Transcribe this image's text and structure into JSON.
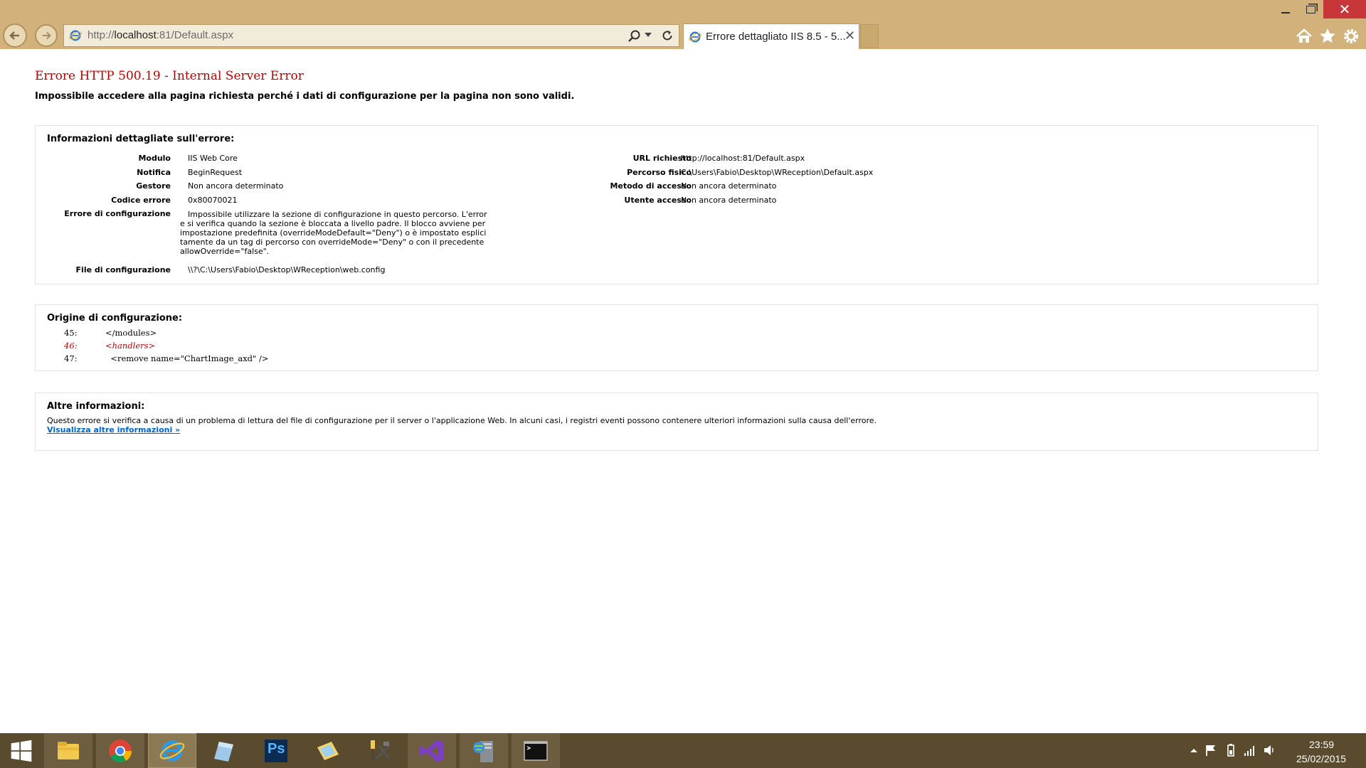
{
  "browser": {
    "url_prefix": "http://",
    "url_host": "localhost",
    "url_rest": ":81/Default.aspx",
    "tab_title": "Errore dettagliato IIS 8.5 - 5...",
    "tab_close": "✕",
    "close_glyph": "✕"
  },
  "page": {
    "title": "Errore HTTP 500.19 - Internal Server Error",
    "subtitle": "Impossibile accedere alla pagina richiesta perché i dati di configurazione per la pagina non sono validi.",
    "details": {
      "heading": "Informazioni dettagliate sull'errore:",
      "left": [
        {
          "label": "Modulo",
          "value": "IIS Web Core"
        },
        {
          "label": "Notifica",
          "value": "BeginRequest"
        },
        {
          "label": "Gestore",
          "value": "Non ancora determinato"
        },
        {
          "label": "Codice errore",
          "value": "0x80070021"
        }
      ],
      "config_error_label": "Errore di configurazione",
      "config_error_value": "Impossibile utilizzare la sezione di configurazione in questo percorso. L'errore si verifica quando la sezione è bloccata a livello padre. Il blocco avviene per impostazione predefinita (overrideModeDefault=\"Deny\") o è impostato esplicitamente da un tag di percorso con overrideMode=\"Deny\" o con il precedente allowOverride=\"false\".",
      "config_file_label": "File di configurazione",
      "config_file_value": "\\\\?\\C:\\Users\\Fabio\\Desktop\\WReception\\web.config",
      "right": [
        {
          "label": "URL richiesto",
          "value": "http://localhost:81/Default.aspx"
        },
        {
          "label": "Percorso fisico",
          "value": "C:\\Users\\Fabio\\Desktop\\WReception\\Default.aspx"
        },
        {
          "label": "Metodo di accesso",
          "value": "Non ancora determinato"
        },
        {
          "label": "Utente accesso",
          "value": "Non ancora determinato"
        }
      ]
    },
    "origin": {
      "heading": "Origine di configurazione:",
      "lines": [
        {
          "num": "45:",
          "code": "</modules>"
        },
        {
          "num": "46:",
          "code": "<handlers>"
        },
        {
          "num": "47:",
          "code": "  <remove name=\"ChartImage_axd\" />"
        }
      ]
    },
    "more": {
      "heading": "Altre informazioni:",
      "text": "Questo errore si verifica a causa di un problema di lettura del file di configurazione per il server o l'applicazione Web. In alcuni casi, i registri eventi possono contenere ulteriori informazioni sulla causa dell'errore.",
      "link": "Visualizza altre informazioni »"
    }
  },
  "taskbar": {
    "apps": [
      "file-explorer-icon",
      "chrome-icon",
      "internet-explorer-icon",
      "notes-icon",
      "photoshop-icon",
      "sticky-folder-icon",
      "tools-icon",
      "visual-studio-icon",
      "server-manager-icon",
      "command-prompt-icon"
    ],
    "ps_label": "Ps",
    "clock_time": "23:59",
    "clock_date": "25/02/2015"
  },
  "colors": {
    "chrome": "#d2b17a",
    "error_red": "#c00000",
    "link_blue": "#0066cc",
    "taskbar": "#5a4a2e"
  }
}
